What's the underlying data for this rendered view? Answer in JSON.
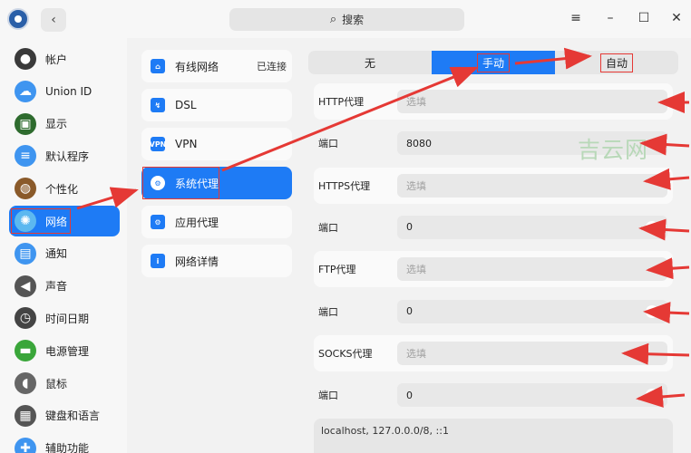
{
  "search": {
    "label": "搜索"
  },
  "sidebar": {
    "items": [
      {
        "label": "帐户",
        "icon": "user-icon",
        "color": "#3a3a3a"
      },
      {
        "label": "Union ID",
        "icon": "cloud-icon",
        "color": "#3f95f0"
      },
      {
        "label": "显示",
        "icon": "monitor-icon",
        "color": "#2e6b2e"
      },
      {
        "label": "默认程序",
        "icon": "list-icon",
        "color": "#3f95f0"
      },
      {
        "label": "个性化",
        "icon": "palette-icon",
        "color": "#8a5a2a"
      },
      {
        "label": "网络",
        "icon": "globe-icon",
        "color": "#5cb8f0"
      },
      {
        "label": "通知",
        "icon": "notification-icon",
        "color": "#3f95f0"
      },
      {
        "label": "声音",
        "icon": "speaker-icon",
        "color": "#555555"
      },
      {
        "label": "时间日期",
        "icon": "clock-icon",
        "color": "#444444"
      },
      {
        "label": "电源管理",
        "icon": "battery-icon",
        "color": "#3aa63a"
      },
      {
        "label": "鼠标",
        "icon": "mouse-icon",
        "color": "#666666"
      },
      {
        "label": "键盘和语言",
        "icon": "keyboard-icon",
        "color": "#555555"
      },
      {
        "label": "辅助功能",
        "icon": "accessibility-icon",
        "color": "#3f95f0"
      }
    ],
    "active_index": 5
  },
  "midcol": {
    "items": [
      {
        "label": "有线网络",
        "status": "已连接",
        "icon": "wired-network-icon",
        "glyph": "⌂"
      },
      {
        "label": "DSL",
        "status": "",
        "icon": "dsl-icon",
        "glyph": "↯"
      },
      {
        "label": "VPN",
        "status": "",
        "icon": "vpn-icon",
        "glyph": "VPN"
      },
      {
        "label": "系统代理",
        "status": "",
        "icon": "system-proxy-icon",
        "glyph": "⚙"
      },
      {
        "label": "应用代理",
        "status": "",
        "icon": "app-proxy-icon",
        "glyph": "⚙"
      },
      {
        "label": "网络详情",
        "status": "",
        "icon": "info-icon",
        "glyph": "i"
      }
    ],
    "active_index": 3
  },
  "proxy": {
    "modes": [
      "无",
      "手动",
      "自动"
    ],
    "selected_mode": 1,
    "rows": [
      {
        "label": "HTTP代理",
        "value": "",
        "placeholder": "选填"
      },
      {
        "label": "端口",
        "value": "8080",
        "placeholder": ""
      },
      {
        "label": "HTTPS代理",
        "value": "",
        "placeholder": "选填"
      },
      {
        "label": "端口",
        "value": "0",
        "placeholder": ""
      },
      {
        "label": "FTP代理",
        "value": "",
        "placeholder": "选填"
      },
      {
        "label": "端口",
        "value": "0",
        "placeholder": ""
      },
      {
        "label": "SOCKS代理",
        "value": "",
        "placeholder": "选填"
      },
      {
        "label": "端口",
        "value": "0",
        "placeholder": ""
      }
    ],
    "ignore_hosts": "localhost, 127.0.0.0/8, ::1"
  },
  "watermark": "吉云网",
  "colors": {
    "accent": "#1e7bf5",
    "annotation": "#e53935"
  }
}
